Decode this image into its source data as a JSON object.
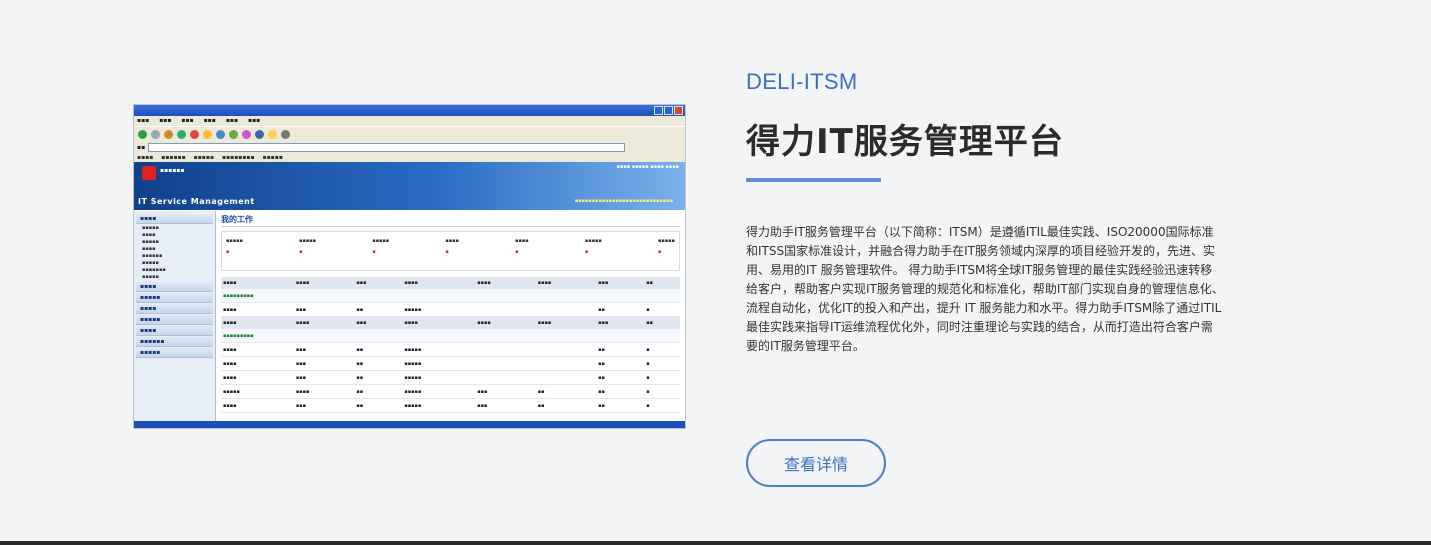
{
  "product": {
    "eyebrow": "DELI-ITSM",
    "title": "得力IT服务管理平台",
    "description": "得力助手IT服务管理平台（以下简称：ITSM）是遵循ITIL最佳实践、ISO20000国际标准和ITSS国家标准设计，并融合得力助手在IT服务领域内深厚的项目经验开发的，先进、实用、易用的IT 服务管理软件。 得力助手ITSM将全球IT服务管理的最佳实践经验迅速转移给客户，帮助客户实现IT服务管理的规范化和标准化，帮助IT部门实现自身的管理信息化、流程自动化，优化IT的投入和产出，提升 IT 服务能力和水平。得力助手ITSM除了通过ITIL最佳实践来指导IT运维流程优化外，同时注重理论与实践的结合，从而打造出符合客户需要的IT服务管理平台。",
    "button_label": "查看详情"
  },
  "screenshot": {
    "banner_brand": "IT Service Management",
    "main_heading": "我的工作"
  },
  "colors": {
    "accent": "#3a6fc4",
    "divider": "#5f8fd8",
    "title": "#2b2b2b",
    "background": "#f3f4f6"
  }
}
